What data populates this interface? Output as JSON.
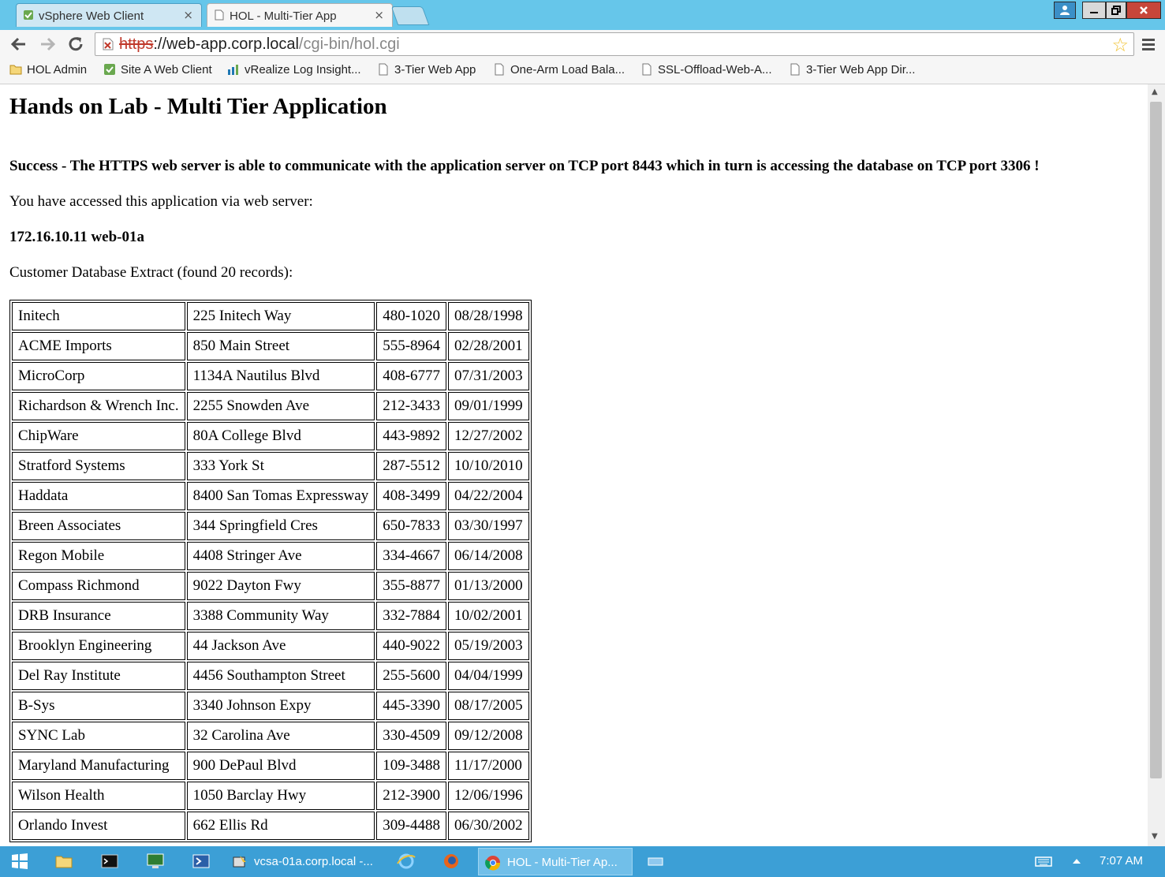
{
  "browser": {
    "tabs": [
      {
        "label": "vSphere Web Client",
        "close": "×"
      },
      {
        "label": "HOL - Multi-Tier App",
        "close": "×"
      }
    ],
    "url": {
      "scheme": "https",
      "rest": "://web-app.corp.local",
      "path": "/cgi-bin/hol.cgi"
    },
    "bookmarks": [
      {
        "label": "HOL Admin",
        "icon": "folder-icon"
      },
      {
        "label": "Site A Web Client",
        "icon": "vsphere-icon"
      },
      {
        "label": "vRealize Log Insight...",
        "icon": "log-insight-icon"
      },
      {
        "label": "3-Tier Web App",
        "icon": "page-icon"
      },
      {
        "label": "One-Arm Load Bala...",
        "icon": "page-icon"
      },
      {
        "label": "SSL-Offload-Web-A...",
        "icon": "page-icon"
      },
      {
        "label": "3-Tier Web App Dir...",
        "icon": "page-icon"
      }
    ]
  },
  "page": {
    "title": "Hands on Lab - Multi Tier Application",
    "success": "Success - The HTTPS web server is able to communicate with the application server on TCP port 8443 which in turn is accessing the database on TCP port 3306 !",
    "accessed": "You have accessed this application via web server:",
    "server": "172.16.10.11 web-01a",
    "extract": "Customer Database Extract (found 20 records):",
    "records": [
      [
        "Initech",
        "225 Initech Way",
        "480-1020",
        "08/28/1998"
      ],
      [
        "ACME Imports",
        "850 Main Street",
        "555-8964",
        "02/28/2001"
      ],
      [
        "MicroCorp",
        "1134A Nautilus Blvd",
        "408-6777",
        "07/31/2003"
      ],
      [
        "Richardson & Wrench Inc.",
        "2255 Snowden Ave",
        "212-3433",
        "09/01/1999"
      ],
      [
        "ChipWare",
        "80A College Blvd",
        "443-9892",
        "12/27/2002"
      ],
      [
        "Stratford Systems",
        "333 York St",
        "287-5512",
        "10/10/2010"
      ],
      [
        "Haddata",
        "8400 San Tomas Expressway",
        "408-3499",
        "04/22/2004"
      ],
      [
        "Breen Associates",
        "344 Springfield Cres",
        "650-7833",
        "03/30/1997"
      ],
      [
        "Regon Mobile",
        "4408 Stringer Ave",
        "334-4667",
        "06/14/2008"
      ],
      [
        "Compass Richmond",
        "9022 Dayton Fwy",
        "355-8877",
        "01/13/2000"
      ],
      [
        "DRB Insurance",
        "3388 Community Way",
        "332-7884",
        "10/02/2001"
      ],
      [
        "Brooklyn Engineering",
        "44 Jackson Ave",
        "440-9022",
        "05/19/2003"
      ],
      [
        "Del Ray Institute",
        "4456 Southampton Street",
        "255-5600",
        "04/04/1999"
      ],
      [
        "B-Sys",
        "3340 Johnson Expy",
        "445-3390",
        "08/17/2005"
      ],
      [
        "SYNC Lab",
        "32 Carolina Ave",
        "330-4509",
        "09/12/2008"
      ],
      [
        "Maryland Manufacturing",
        "900 DePaul Blvd",
        "109-3488",
        "11/17/2000"
      ],
      [
        "Wilson Health",
        "1050 Barclay Hwy",
        "212-3900",
        "12/06/1996"
      ],
      [
        "Orlando Invest",
        "662 Ellis Rd",
        "309-4488",
        "06/30/2002"
      ]
    ]
  },
  "taskbar": {
    "items": [
      {
        "label": "vcsa-01a.corp.local -..."
      },
      {
        "label": "HOL - Multi-Tier Ap..."
      }
    ],
    "clock": "7:07 AM"
  },
  "colors": {
    "titlebar": "#66c6ea",
    "taskbar": "#3c9fd6",
    "close_button": "#c7463a",
    "bookmark_star": "#f1c232"
  }
}
